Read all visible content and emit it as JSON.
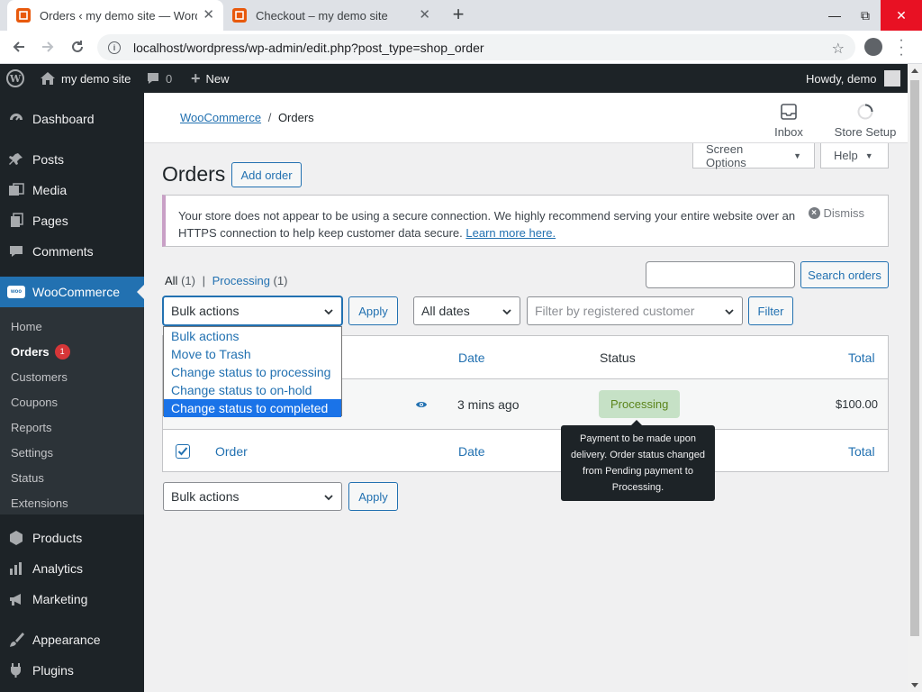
{
  "browser": {
    "tabs": [
      {
        "title": "Orders ‹ my demo site — WordPress"
      },
      {
        "title": "Checkout – my demo site"
      }
    ],
    "new_tab_label": "+",
    "url": "localhost/wordpress/wp-admin/edit.php?post_type=shop_order"
  },
  "adminbar": {
    "site_name": "my demo site",
    "comments_count": "0",
    "new_label": "New",
    "howdy": "Howdy, demo"
  },
  "sidebar": {
    "items": [
      {
        "label": "Dashboard",
        "icon": "dashboard-icon"
      },
      {
        "label": "Posts",
        "icon": "pin-icon"
      },
      {
        "label": "Media",
        "icon": "media-icon"
      },
      {
        "label": "Pages",
        "icon": "pages-icon"
      },
      {
        "label": "Comments",
        "icon": "comment-icon"
      },
      {
        "label": "WooCommerce",
        "icon": "woo-icon",
        "logo_text": "woo"
      },
      {
        "label": "Products",
        "icon": "products-icon"
      },
      {
        "label": "Analytics",
        "icon": "analytics-icon"
      },
      {
        "label": "Marketing",
        "icon": "megaphone-icon"
      },
      {
        "label": "Appearance",
        "icon": "brush-icon"
      },
      {
        "label": "Plugins",
        "icon": "plugin-icon"
      }
    ],
    "woo_submenu": [
      {
        "label": "Home"
      },
      {
        "label": "Orders",
        "badge": "1"
      },
      {
        "label": "Customers"
      },
      {
        "label": "Coupons"
      },
      {
        "label": "Reports"
      },
      {
        "label": "Settings"
      },
      {
        "label": "Status"
      },
      {
        "label": "Extensions"
      }
    ]
  },
  "wc_header": {
    "breadcrumb_root": "WooCommerce",
    "breadcrumb_sep": "/",
    "breadcrumb_current": "Orders",
    "inbox_label": "Inbox",
    "store_setup_label": "Store Setup"
  },
  "screen_options_label": "Screen Options",
  "help_label": "Help",
  "page": {
    "title": "Orders",
    "add_order_label": "Add order"
  },
  "notice": {
    "text": "Your store does not appear to be using a secure connection. We highly recommend serving your entire website over an HTTPS connection to help keep customer data secure.",
    "link": "Learn more here.",
    "dismiss": "Dismiss"
  },
  "filters": {
    "all_label": "All",
    "all_count": "(1)",
    "separator": "|",
    "processing_label": "Processing",
    "processing_count": "(1)",
    "search_button": "Search orders",
    "bulk_selected": "Bulk actions",
    "apply": "Apply",
    "dates_selected": "All dates",
    "customer_placeholder": "Filter by registered customer",
    "filter_button": "Filter"
  },
  "bulk_options": [
    "Bulk actions",
    "Move to Trash",
    "Change status to processing",
    "Change status to on-hold",
    "Change status to completed"
  ],
  "table": {
    "columns": {
      "order": "Order",
      "date": "Date",
      "status": "Status",
      "total": "Total"
    },
    "rows": [
      {
        "date": "3 mins ago",
        "status": "Processing",
        "total": "$100.00"
      }
    ]
  },
  "tooltip": {
    "text": "Payment to be made upon delivery. Order status changed from Pending payment to Processing."
  },
  "bottom": {
    "bulk_selected": "Bulk actions",
    "apply": "Apply"
  }
}
